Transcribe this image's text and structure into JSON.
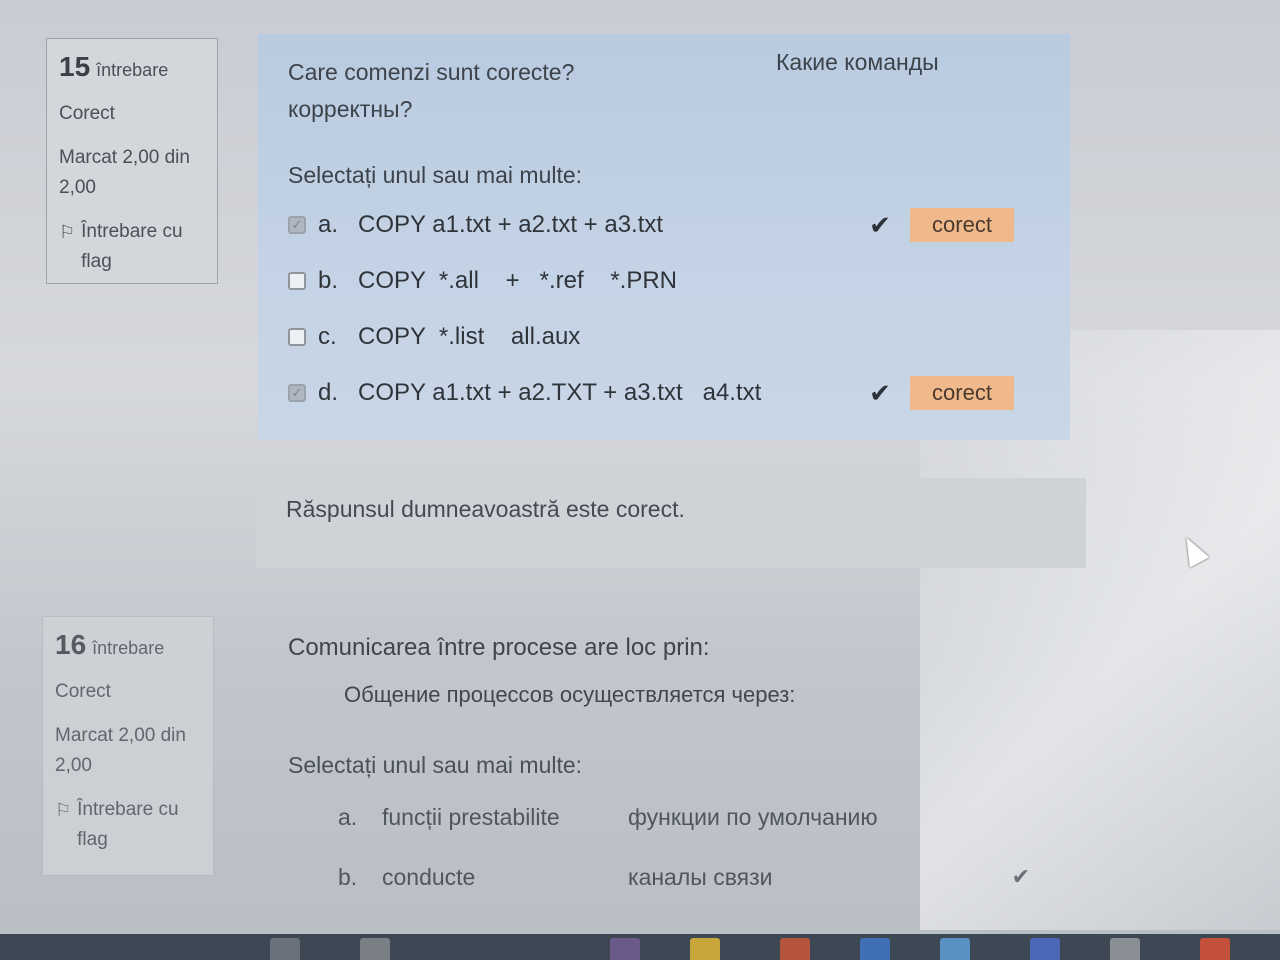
{
  "question15": {
    "number": "15",
    "word": "întrebare",
    "status": "Corect",
    "mark": "Marcat 2,00 din 2,00",
    "flag_label": "Întrebare cu flag",
    "text_ro": "Care comenzi sunt corecte?",
    "text_ru_a": "Какие команды",
    "text_ru_b": "корректны?",
    "prompt": "Selectați unul sau mai multe:",
    "options": [
      {
        "letter": "a.",
        "text": "COPY a1.txt + a2.txt + a3.txt",
        "checked": true,
        "feedback": "corect"
      },
      {
        "letter": "b.",
        "text": "COPY  *.all    +   *.ref    *.PRN",
        "checked": false,
        "feedback": ""
      },
      {
        "letter": "c.",
        "text": "COPY  *.list    all.aux",
        "checked": false,
        "feedback": ""
      },
      {
        "letter": "d.",
        "text": "COPY a1.txt + a2.TXT + a3.txt   a4.txt",
        "checked": true,
        "feedback": "corect"
      }
    ],
    "outcome": "Răspunsul dumneavoastră este corect."
  },
  "question16": {
    "number": "16",
    "word": "întrebare",
    "status": "Corect",
    "mark": "Marcat 2,00 din 2,00",
    "flag_label": "Întrebare cu flag",
    "text_ro": "Comunicarea între procese are loc prin:",
    "text_ru": "Общение процессов  осуществляется через:",
    "prompt": "Selectați unul sau mai multe:",
    "options": [
      {
        "letter": "a.",
        "text": "funcții prestabilite",
        "ru": "функции по умолчанию"
      },
      {
        "letter": "b.",
        "text": "conducte",
        "ru": "каналы связи"
      }
    ]
  },
  "icons": {
    "check": "check-icon",
    "flag": "flag-icon",
    "cursor": "mouse-cursor-icon"
  },
  "colors": {
    "question_bg": "#c4d3e5",
    "correct_badge": "#f0b98c",
    "outcome_bg": "#cfd3d8",
    "taskbar": "#3e4754"
  }
}
